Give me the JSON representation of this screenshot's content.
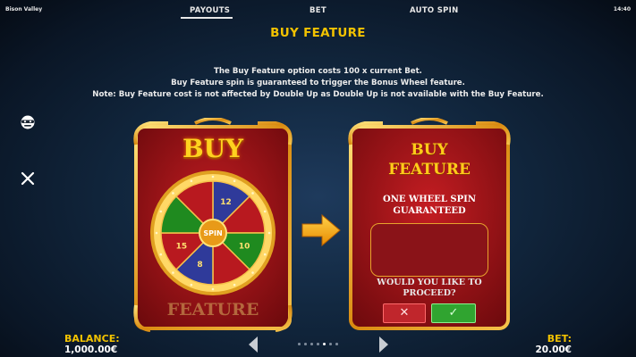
{
  "app": {
    "title": "Bison Valley",
    "clock": "14:40"
  },
  "tabs": [
    {
      "label": "PAYOUTS",
      "active": true
    },
    {
      "label": "BET",
      "active": false
    },
    {
      "label": "AUTO SPIN",
      "active": false
    }
  ],
  "page": {
    "heading": "BUY FEATURE",
    "lines": [
      "The Buy Feature option costs 100 x current Bet.",
      "Buy Feature spin is guaranteed to trigger the Bonus Wheel feature.",
      "Note: Buy Feature cost is not affected by Double Up as Double Up is not available with the Buy Feature."
    ]
  },
  "left_card": {
    "top_text": "BUY",
    "bottom_text": "FEATURE",
    "wheel": {
      "center_label": "SPIN",
      "segment_labels": [
        "12",
        "10",
        "15",
        "8"
      ],
      "segment_colors": [
        "#2f3a9a",
        "#b8191f",
        "#1f8a1f",
        "#b8191f",
        "#2f3a9a",
        "#b8191f",
        "#1f8a1f",
        "#b8191f"
      ]
    }
  },
  "right_card": {
    "line1": "BUY",
    "line2": "FEATURE",
    "sub1": "ONE WHEEL SPIN",
    "sub2": "GUARANTEED",
    "question1": "WOULD YOU LIKE TO",
    "question2": "PROCEED?",
    "cancel_symbol": "✕",
    "confirm_symbol": "✓"
  },
  "footer": {
    "balance_label": "BALANCE:",
    "balance_value": "1,000.00€",
    "bet_label": "BET:",
    "bet_value": "20.00€",
    "pager": {
      "total": 7,
      "current": 5
    }
  },
  "colors": {
    "accent": "#f2c200",
    "card_red": "#9e1418",
    "frame_gold": "#e8a020"
  },
  "icons": {
    "side_top": "mask-icon",
    "side_bottom": "close-icon",
    "prev": "chevron-left-icon",
    "next": "chevron-right-icon",
    "arrow": "arrow-right-icon"
  }
}
